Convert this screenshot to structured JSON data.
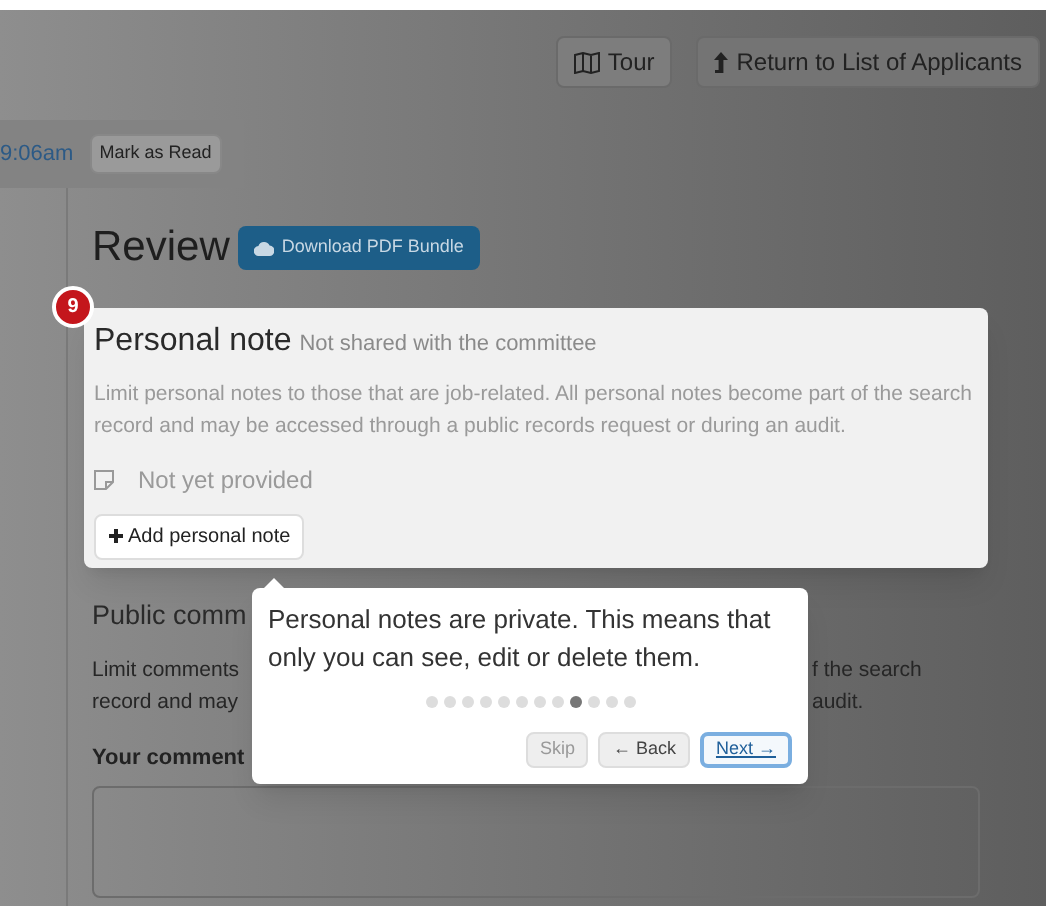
{
  "tour_button": {
    "label": "Tour"
  },
  "return_button": {
    "label": "Return to List of Applicants"
  },
  "message_bar": {
    "time": "9:06am",
    "mark_read_button": "Mark as Read"
  },
  "review": {
    "title": "Review",
    "download_button": "Download PDF Bundle"
  },
  "tour_step_badge": "9",
  "personal_note": {
    "title": "Personal note",
    "subtitle": "Not shared with the committee",
    "description": "Limit personal notes to those that are job-related. All personal notes become part of the search record and may be accessed through a public records request or during an audit.",
    "status": "Not yet provided",
    "add_button": "Add personal note"
  },
  "public_comment": {
    "heading": "Public comm",
    "line_1_left": "Limit comments",
    "line_1_right": "f the search",
    "line_2_left": "record and may",
    "line_2_right": "audit.",
    "comment_label": "Your comment"
  },
  "tour_popover": {
    "text": "Personal notes are private. This means that only you can see, edit or delete them.",
    "steps": [
      {
        "selected": false
      },
      {
        "selected": false
      },
      {
        "selected": false
      },
      {
        "selected": false
      },
      {
        "selected": false
      },
      {
        "selected": false
      },
      {
        "selected": false
      },
      {
        "selected": false
      },
      {
        "selected": true
      },
      {
        "selected": false
      },
      {
        "selected": false
      },
      {
        "selected": false
      }
    ],
    "buttons": [
      {
        "label": "Skip",
        "kind": "skip"
      },
      {
        "label": "← Back",
        "kind": "back"
      },
      {
        "label": "Next →",
        "kind": "next"
      }
    ]
  }
}
